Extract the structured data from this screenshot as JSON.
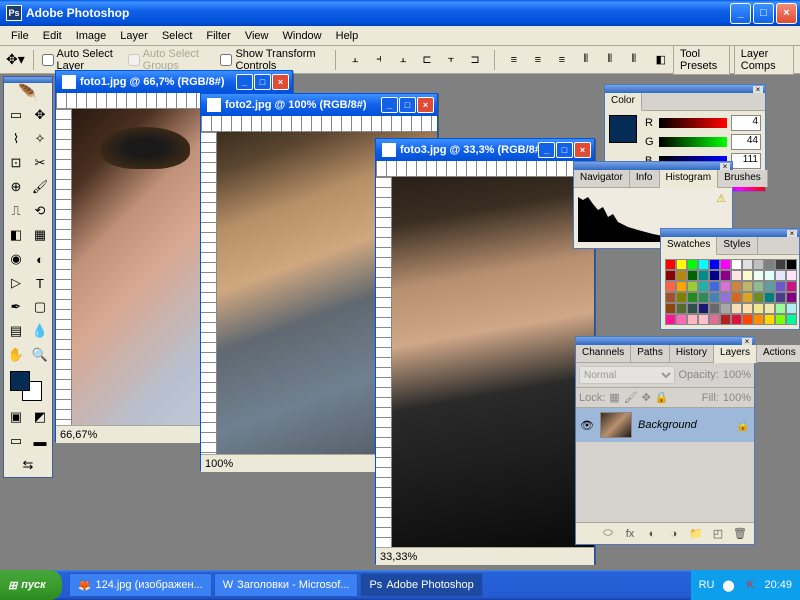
{
  "app": {
    "title": "Adobe Photoshop"
  },
  "menu": [
    "File",
    "Edit",
    "Image",
    "Layer",
    "Select",
    "Filter",
    "View",
    "Window",
    "Help"
  ],
  "options": {
    "auto_select_layer": "Auto Select Layer",
    "auto_select_groups": "Auto Select Groups",
    "show_transform": "Show Transform Controls",
    "tool_presets": "Tool Presets",
    "layer_comps": "Layer Comps"
  },
  "docs": [
    {
      "title": "foto1.jpg @ 66,7% (RGB/8#)",
      "zoom": "66,67%"
    },
    {
      "title": "foto2.jpg @ 100% (RGB/8#)",
      "zoom": "100%"
    },
    {
      "title": "foto3.jpg @ 33,3% (RGB/8#)",
      "zoom": "33,33%"
    }
  ],
  "color": {
    "tab": "Color",
    "r": "4",
    "g": "44",
    "b": "111"
  },
  "histogram": {
    "tabs": [
      "Navigator",
      "Info",
      "Histogram",
      "Brushes"
    ],
    "active": "Histogram"
  },
  "swatches": {
    "tabs": [
      "Swatches",
      "Styles"
    ],
    "active": "Swatches"
  },
  "layers": {
    "tabs": [
      "Channels",
      "Paths",
      "History",
      "Layers",
      "Actions"
    ],
    "active": "Layers",
    "mode": "Normal",
    "opacity_label": "Opacity:",
    "opacity": "100%",
    "lock_label": "Lock:",
    "fill_label": "Fill:",
    "fill": "100%",
    "layer_name": "Background"
  },
  "taskbar": {
    "start": "пуск",
    "items": [
      "124.jpg (изображен...",
      "Заголовки - Microsof...",
      "Adobe Photoshop"
    ],
    "lang": "RU",
    "time": "20:49"
  }
}
